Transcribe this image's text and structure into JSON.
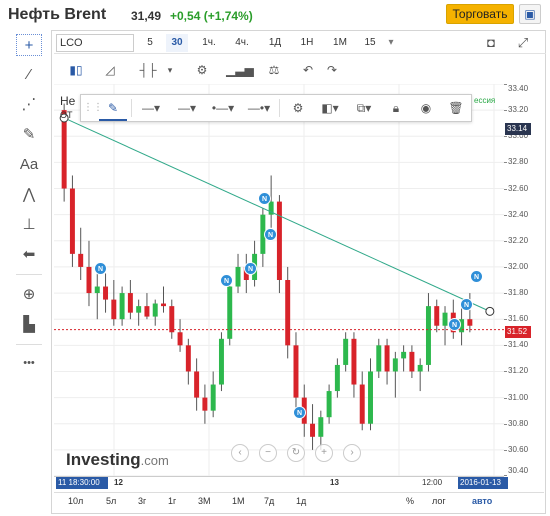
{
  "header": {
    "title": "Нефть Brent",
    "price": "31,49",
    "change": "+0,54 (+1,74%)",
    "change_color": "#2a9d2a",
    "trade_label": "Торговать",
    "portfolio_icon": "portfolio-add-icon"
  },
  "toolbar": {
    "symbol_value": "LCO",
    "timeframes": [
      "5",
      "30",
      "1ч.",
      "4ч.",
      "1Д",
      "1Н",
      "1М",
      "15"
    ],
    "selected_timeframe": "30",
    "camera_icon": "camera-icon",
    "fullscreen_icon": "fullscreen-icon",
    "row2_icons": [
      "candles-icon",
      "area-chart-icon",
      "bars-icon",
      "dropdown-icon",
      "settings-icon",
      "indicators-icon",
      "compare-icon",
      "undo-icon",
      "redo-icon"
    ]
  },
  "left_tools": [
    "crosshair-icon",
    "trendline-icon",
    "fib-icon",
    "brush-icon",
    "text-icon",
    "pattern-icon",
    "measure-icon",
    "arrow-left-icon",
    "zoom-icon",
    "ruler-icon",
    "more-icon"
  ],
  "left_tools_labels": {
    "text": "Aa",
    "more": "•••"
  },
  "legend": {
    "name": "Не",
    "sub": "OT",
    "session": "ессия"
  },
  "drawing_toolbar": {
    "icons": [
      "drag-handle-icon",
      "pencil-icon",
      "line-style-icon",
      "line-width-icon",
      "line-ends-icon",
      "line-arrow-icon",
      "settings-icon",
      "visual-order-icon",
      "clone-icon",
      "lock-icon",
      "visibility-icon",
      "trash-icon"
    ]
  },
  "y_axis": {
    "ticks": [
      "33.40",
      "33.20",
      "33.00",
      "32.80",
      "32.60",
      "32.40",
      "32.20",
      "32.00",
      "31.80",
      "31.60",
      "31.40",
      "31.20",
      "31.00",
      "30.80",
      "30.60",
      "30.40"
    ],
    "tag_top": "33.14",
    "tag_current": "31.52",
    "tag_top_color": "#2a3550",
    "tag_current_color": "#d8232a"
  },
  "x_axis": {
    "start_tag": "11 18:30:00",
    "ticks": [
      "12",
      "13",
      "12:00"
    ],
    "end_tag": "2016-01-13"
  },
  "ranges": [
    "10л",
    "5л",
    "3г",
    "1г",
    "3М",
    "1М",
    "7д",
    "1д"
  ],
  "range_options": [
    "%",
    "лог",
    "авто"
  ],
  "selected_range_option": "авто",
  "logo": {
    "main": "Investing",
    "suffix": ".com"
  },
  "nav_buttons": [
    "scroll-left-icon",
    "zoom-out-icon",
    "reset-icon",
    "zoom-in-icon",
    "scroll-right-icon"
  ],
  "badges": [
    "N",
    "N",
    "N",
    "N",
    "N",
    "N",
    "N",
    "N",
    "N"
  ],
  "colors": {
    "up": "#2db84d",
    "down": "#d8232a",
    "trendline": "#31a98a",
    "accent": "#2a5aa6"
  },
  "chart_data": {
    "type": "candlestick",
    "ylim": [
      30.4,
      33.4
    ],
    "candles": [
      [
        33.2,
        33.25,
        32.5,
        32.6
      ],
      [
        32.6,
        32.7,
        32.0,
        32.1
      ],
      [
        32.1,
        32.3,
        31.9,
        32.0
      ],
      [
        32.0,
        32.2,
        31.7,
        31.8
      ],
      [
        31.8,
        32.0,
        31.6,
        31.85
      ],
      [
        31.85,
        31.95,
        31.65,
        31.75
      ],
      [
        31.75,
        31.9,
        31.55,
        31.6
      ],
      [
        31.6,
        31.85,
        31.55,
        31.8
      ],
      [
        31.8,
        31.9,
        31.6,
        31.65
      ],
      [
        31.65,
        31.75,
        31.55,
        31.7
      ],
      [
        31.7,
        31.8,
        31.6,
        31.62
      ],
      [
        31.62,
        31.75,
        31.55,
        31.72
      ],
      [
        31.72,
        31.85,
        31.65,
        31.7
      ],
      [
        31.7,
        31.75,
        31.45,
        31.5
      ],
      [
        31.5,
        31.6,
        31.35,
        31.4
      ],
      [
        31.4,
        31.45,
        31.1,
        31.2
      ],
      [
        31.2,
        31.3,
        30.9,
        31.0
      ],
      [
        31.0,
        31.1,
        30.8,
        30.9
      ],
      [
        30.9,
        31.2,
        30.85,
        31.1
      ],
      [
        31.1,
        31.5,
        31.05,
        31.45
      ],
      [
        31.45,
        31.9,
        31.4,
        31.85
      ],
      [
        31.85,
        32.1,
        31.8,
        32.0
      ],
      [
        32.0,
        32.1,
        31.8,
        31.9
      ],
      [
        31.9,
        32.2,
        31.85,
        32.1
      ],
      [
        32.1,
        32.45,
        32.0,
        32.4
      ],
      [
        32.4,
        32.7,
        32.3,
        32.5
      ],
      [
        32.5,
        32.55,
        31.8,
        31.9
      ],
      [
        31.9,
        32.0,
        31.3,
        31.4
      ],
      [
        31.4,
        31.5,
        30.9,
        31.0
      ],
      [
        31.0,
        31.1,
        30.7,
        30.8
      ],
      [
        30.8,
        30.95,
        30.6,
        30.7
      ],
      [
        30.7,
        30.9,
        30.6,
        30.85
      ],
      [
        30.85,
        31.1,
        30.8,
        31.05
      ],
      [
        31.05,
        31.3,
        31.0,
        31.25
      ],
      [
        31.25,
        31.5,
        31.2,
        31.45
      ],
      [
        31.45,
        31.5,
        31.0,
        31.1
      ],
      [
        31.1,
        31.2,
        30.75,
        30.8
      ],
      [
        30.8,
        31.3,
        30.75,
        31.2
      ],
      [
        31.2,
        31.45,
        31.15,
        31.4
      ],
      [
        31.4,
        31.45,
        31.1,
        31.2
      ],
      [
        31.2,
        31.35,
        31.0,
        31.3
      ],
      [
        31.3,
        31.4,
        31.2,
        31.35
      ],
      [
        31.35,
        31.4,
        31.15,
        31.2
      ],
      [
        31.2,
        31.3,
        31.05,
        31.25
      ],
      [
        31.25,
        31.8,
        31.2,
        31.7
      ],
      [
        31.7,
        31.75,
        31.5,
        31.55
      ],
      [
        31.55,
        31.7,
        31.4,
        31.65
      ],
      [
        31.65,
        31.75,
        31.45,
        31.5
      ],
      [
        31.5,
        31.7,
        31.4,
        31.6
      ],
      [
        31.6,
        31.8,
        31.5,
        31.55
      ]
    ],
    "trendline": {
      "from": [
        0,
        33.14
      ],
      "to": [
        49,
        31.66
      ]
    },
    "current_price": 31.52
  }
}
